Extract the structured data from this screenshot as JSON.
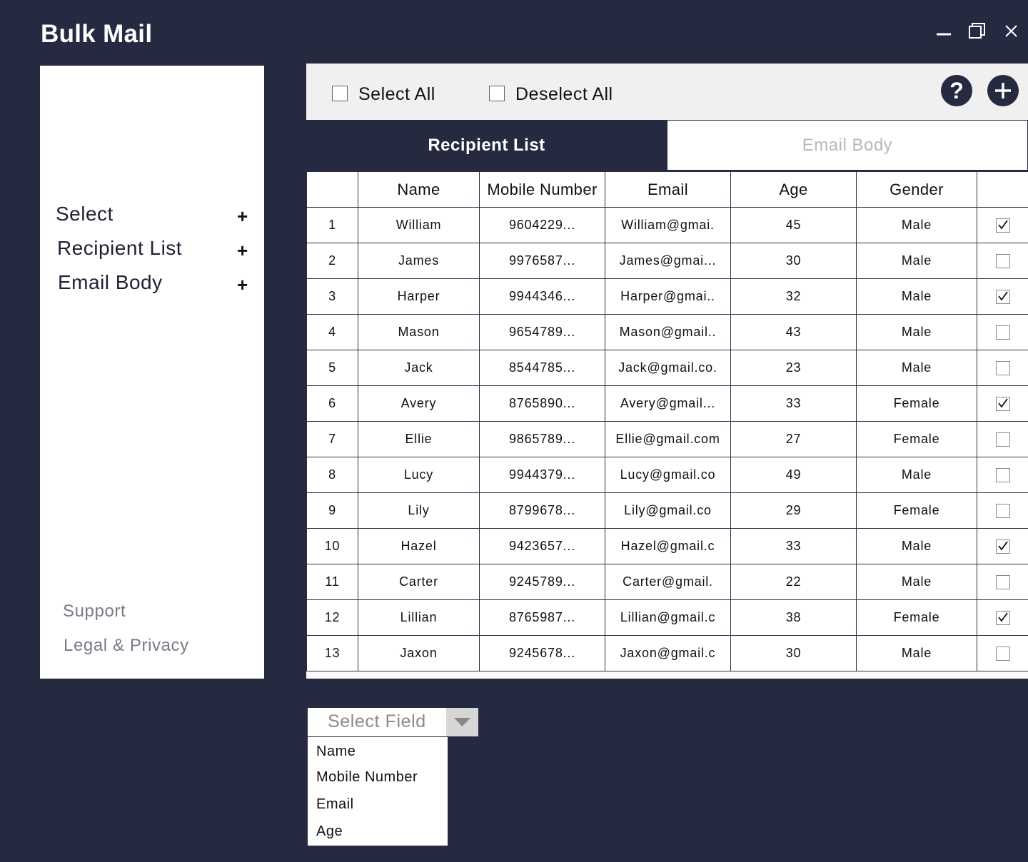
{
  "app": {
    "title": "Bulk Mail"
  },
  "window_controls": {
    "minimize_icon": "minimize-icon",
    "maximize_icon": "maximize-icon",
    "close_icon": "close-icon"
  },
  "sidebar": {
    "items": [
      {
        "label": "Select",
        "icon": "plus-icon"
      },
      {
        "label": "Recipient List",
        "icon": "plus-icon"
      },
      {
        "label": "Email Body",
        "icon": "plus-icon"
      }
    ],
    "plus_symbol": "+",
    "links": [
      {
        "label": "Support"
      },
      {
        "label": "Legal & Privacy"
      }
    ]
  },
  "toolbar": {
    "select_all": "Select All",
    "deselect_all": "Deselect All",
    "help_icon": "help-icon",
    "add_icon": "add-icon"
  },
  "tabs": [
    {
      "label": "Recipient List",
      "active": true
    },
    {
      "label": "Email Body",
      "active": false
    }
  ],
  "table": {
    "columns": [
      "",
      "Name",
      "Mobile Number",
      "Email",
      "Age",
      "Gender",
      ""
    ],
    "rows": [
      {
        "index": "1",
        "name": "William",
        "mobile": "9604229...",
        "email": "William@gmai.",
        "age": "45",
        "gender": "Male",
        "checked": true
      },
      {
        "index": "2",
        "name": "James",
        "mobile": "9976587...",
        "email": "James@gmai...",
        "age": "30",
        "gender": "Male",
        "checked": false
      },
      {
        "index": "3",
        "name": "Harper",
        "mobile": "9944346...",
        "email": "Harper@gmai..",
        "age": "32",
        "gender": "Male",
        "checked": true
      },
      {
        "index": "4",
        "name": "Mason",
        "mobile": "9654789...",
        "email": "Mason@gmail..",
        "age": "43",
        "gender": "Male",
        "checked": false
      },
      {
        "index": "5",
        "name": "Jack",
        "mobile": "8544785...",
        "email": "Jack@gmail.co.",
        "age": "23",
        "gender": "Male",
        "checked": false
      },
      {
        "index": "6",
        "name": "Avery",
        "mobile": "8765890...",
        "email": "Avery@gmail...",
        "age": "33",
        "gender": "Female",
        "checked": true
      },
      {
        "index": "7",
        "name": "Ellie",
        "mobile": "9865789...",
        "email": "Ellie@gmail.com",
        "age": "27",
        "gender": "Female",
        "checked": false
      },
      {
        "index": "8",
        "name": "Lucy",
        "mobile": "9944379...",
        "email": "Lucy@gmail.co",
        "age": "49",
        "gender": "Male",
        "checked": false
      },
      {
        "index": "9",
        "name": "Lily",
        "mobile": "8799678...",
        "email": "Lily@gmail.co",
        "age": "29",
        "gender": "Female",
        "checked": false
      },
      {
        "index": "10",
        "name": "Hazel",
        "mobile": "9423657...",
        "email": "Hazel@gmail.c",
        "age": "33",
        "gender": "Male",
        "checked": true
      },
      {
        "index": "11",
        "name": "Carter",
        "mobile": "9245789...",
        "email": "Carter@gmail.",
        "age": "22",
        "gender": "Male",
        "checked": false
      },
      {
        "index": "12",
        "name": "Lillian",
        "mobile": "8765987...",
        "email": "Lillian@gmail.c",
        "age": "38",
        "gender": "Female",
        "checked": true
      },
      {
        "index": "13",
        "name": "Jaxon",
        "mobile": "9245678...",
        "email": "Jaxon@gmail.c",
        "age": "30",
        "gender": "Male",
        "checked": false
      }
    ]
  },
  "select_field": {
    "placeholder": "Select Field",
    "arrow_icon": "caret-down-icon",
    "options": [
      "Name",
      "Mobile Number",
      "Email",
      "Age"
    ]
  },
  "colors": {
    "background": "#252a40",
    "panel": "#ffffff",
    "toolbar": "#f0f0f0",
    "muted_text": "#777b86"
  }
}
